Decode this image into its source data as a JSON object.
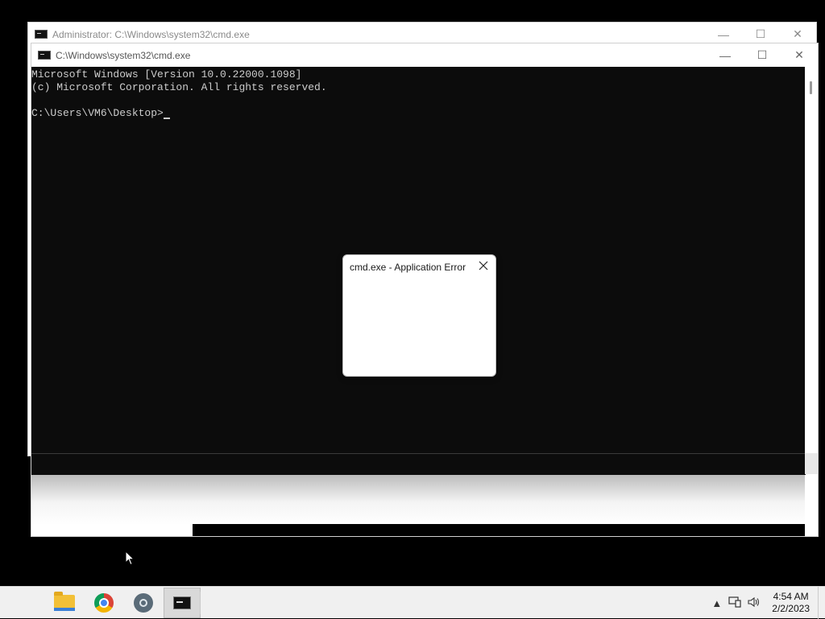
{
  "back_window": {
    "title": "Administrator: C:\\Windows\\system32\\cmd.exe",
    "controls": {
      "minimize": "—",
      "maximize": "☐",
      "close": "✕"
    }
  },
  "front_window": {
    "title": "C:\\Windows\\system32\\cmd.exe",
    "controls": {
      "minimize": "—",
      "maximize": "☐",
      "close": "✕"
    },
    "console_lines": [
      "Microsoft Windows [Version 10.0.22000.1098]",
      "(c) Microsoft Corporation. All rights reserved.",
      "",
      "C:\\Users\\VM6\\Desktop>"
    ]
  },
  "error_dialog": {
    "title": "cmd.exe - Application Error"
  },
  "taskbar": {
    "apps": [
      {
        "name": "File Explorer",
        "icon": "folder-icon"
      },
      {
        "name": "Google Chrome",
        "icon": "chrome-icon"
      },
      {
        "name": "Steam",
        "icon": "steam-icon"
      },
      {
        "name": "Command Prompt",
        "icon": "cmd-icon",
        "active": true
      }
    ],
    "tray": {
      "time": "4:54 AM",
      "date": "2/2/2023"
    }
  }
}
